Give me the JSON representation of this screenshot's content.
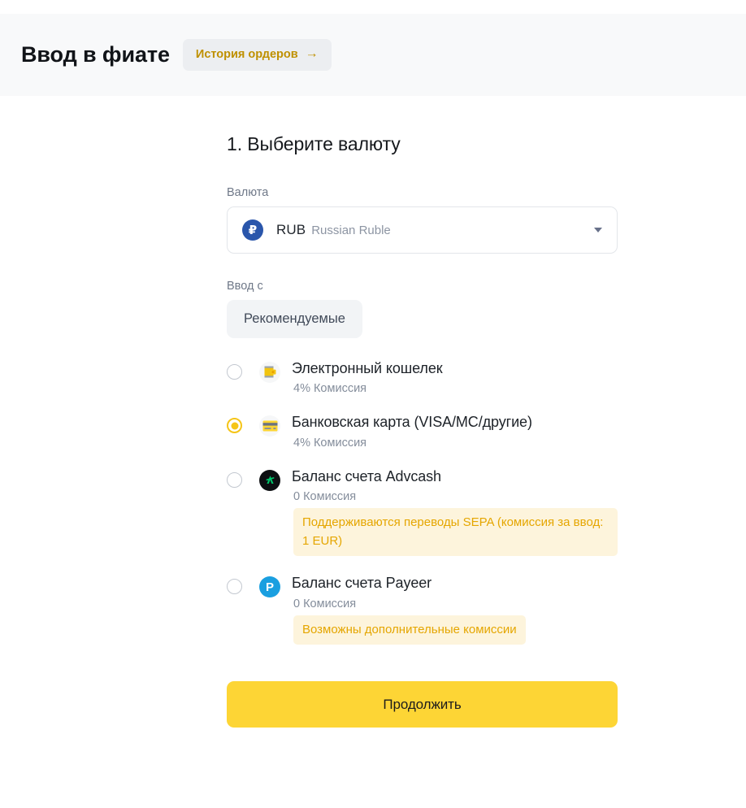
{
  "header": {
    "title": "Ввод в фиате",
    "history_button": {
      "label": "История ордеров",
      "arrow": "→",
      "text_color": "#bf9000",
      "background": "#eceef1"
    },
    "band_background": "#f8f9fa"
  },
  "step": {
    "title": "1. Выберите валюту"
  },
  "currency": {
    "label": "Валюта",
    "selected": {
      "icon": "rub-coin-icon",
      "icon_symbol": "₽",
      "icon_color": "#2a56ab",
      "code": "RUB",
      "name": "Russian Ruble"
    },
    "caret": "chevron-down-icon"
  },
  "source": {
    "label": "Ввод с",
    "tabs": [
      {
        "label": "Рекомендуемые",
        "active": true
      }
    ],
    "options": [
      {
        "id": "e-wallet",
        "icon": "wallet-icon",
        "title": "Электронный кошелек",
        "fee": "4% Комиссия",
        "note": null,
        "selected": false
      },
      {
        "id": "bank-card",
        "icon": "credit-card-icon",
        "title": "Банковская карта (VISA/MC/другие)",
        "fee": "4% Комиссия",
        "note": null,
        "selected": true
      },
      {
        "id": "advcash",
        "icon": "advcash-icon",
        "title": "Баланс счета Advcash",
        "fee": "0 Комиссия",
        "note": "Поддерживаются переводы SEPA (комиссия за ввод: 1 EUR)",
        "note_wide": true,
        "selected": false
      },
      {
        "id": "payeer",
        "icon": "payeer-icon",
        "icon_symbol": "P",
        "title": "Баланс счета Payeer",
        "fee": "0 Комиссия",
        "note": "Возможны дополнительные комиссии",
        "note_wide": false,
        "selected": false
      }
    ]
  },
  "submit": {
    "label": "Продолжить",
    "background": "#fdd535"
  },
  "colors": {
    "accent_yellow": "#fdd535",
    "radio_selected": "#f5c518",
    "note_bg": "#fdf4dc",
    "note_text": "#e5a600"
  }
}
